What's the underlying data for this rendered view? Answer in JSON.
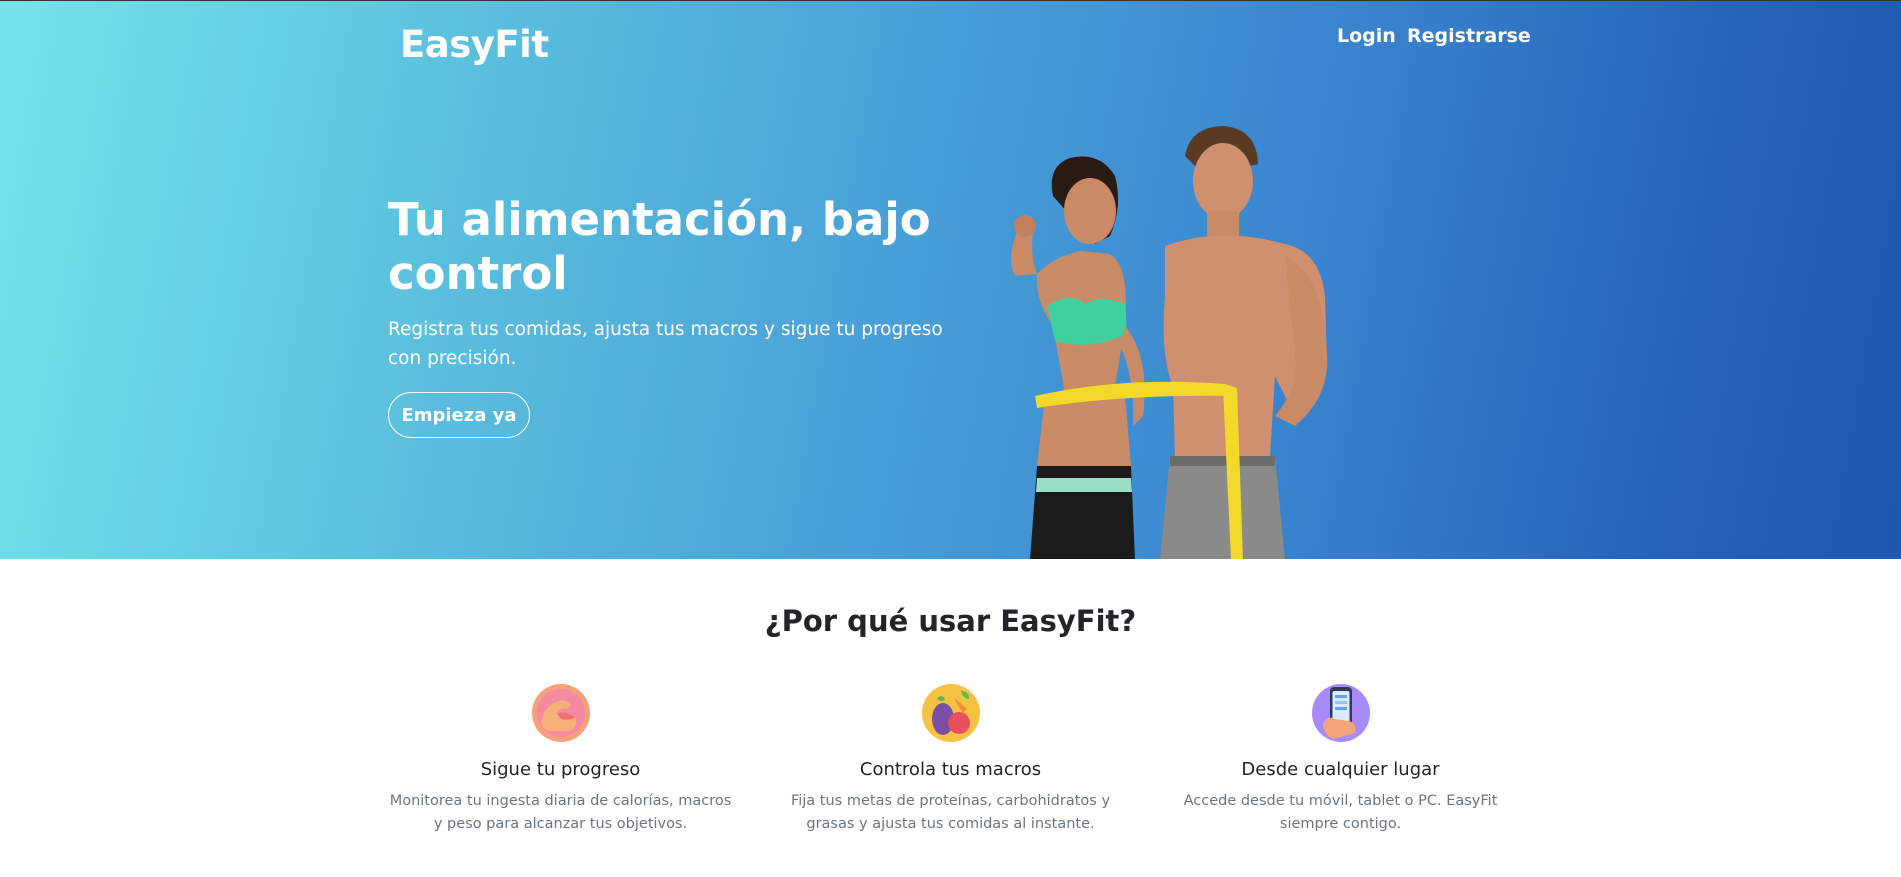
{
  "navbar": {
    "brand": "EasyFit",
    "login_label": "Login",
    "register_label": "Registrarse"
  },
  "hero": {
    "title": "Tu alimentación, bajo control",
    "subtitle": "Registra tus comidas, ajusta tus macros y sigue tu progreso con precisión.",
    "cta_label": "Empieza ya",
    "image_icon": "fitness-couple-measuring-tape-photo"
  },
  "why": {
    "title": "¿Por qué usar EasyFit?",
    "features": [
      {
        "icon": "flexed-arm-icon",
        "title": "Sigue tu progreso",
        "description": "Monitorea tu ingesta diaria de calorías, macros y peso para alcanzar tus objetivos."
      },
      {
        "icon": "vegetables-icon",
        "title": "Controla tus macros",
        "description": "Fija tus metas de proteínas, carbohidratos y grasas y ajusta tus comidas al instante."
      },
      {
        "icon": "phone-in-hand-icon",
        "title": "Desde cualquier lugar",
        "description": "Accede desde tu móvil, tablet o PC. EasyFit siempre contigo."
      }
    ]
  },
  "colors": {
    "hero_gradient_start": "#74e3ea",
    "hero_gradient_end": "#1f58b0",
    "text_dark": "#212529",
    "text_muted": "#6c757d"
  }
}
